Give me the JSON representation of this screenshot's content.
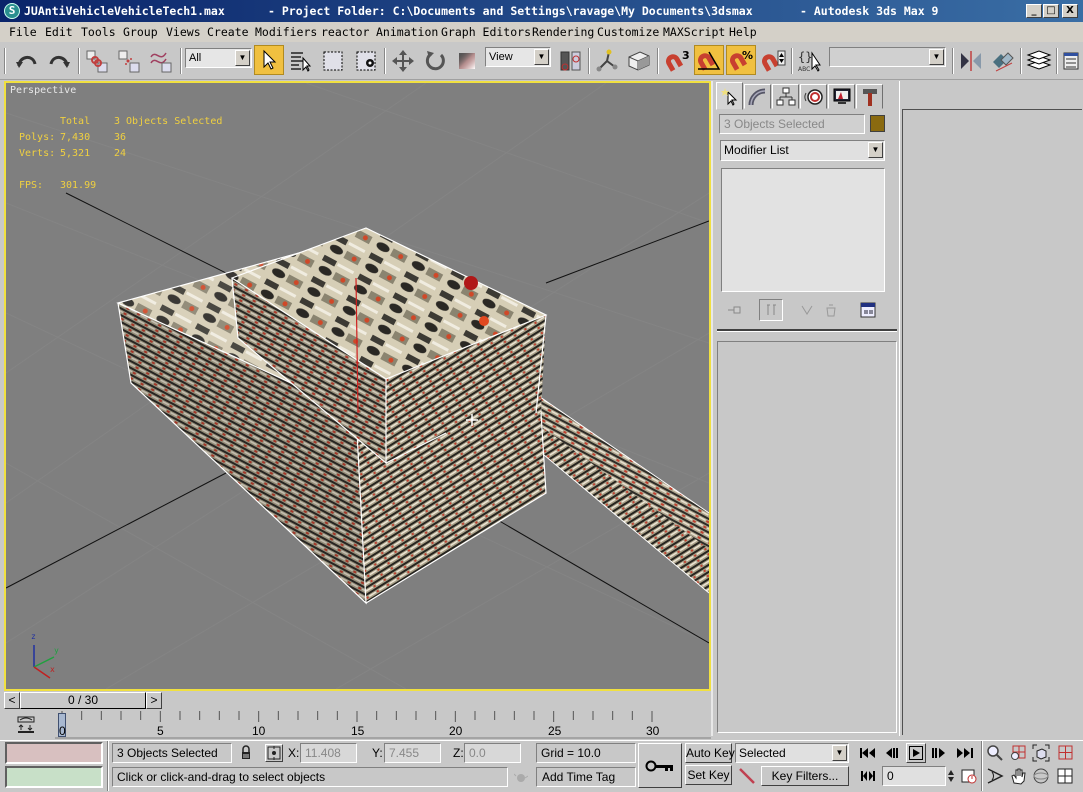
{
  "window": {
    "file_name": "JUAntiVehicleVehicleTech1.max",
    "project_folder": "- Project Folder: C:\\Documents and Settings\\ravage\\My Documents\\3dsmax",
    "app_name": "- Autodesk 3ds Max 9",
    "minimize": "_",
    "maximize": "□",
    "close": "X"
  },
  "menu": [
    "File",
    "Edit",
    "Tools",
    "Group",
    "Views",
    "Create",
    "Modifiers",
    "reactor",
    "Animation",
    "Graph Editors",
    "Rendering",
    "Customize",
    "MAXScript",
    "Help"
  ],
  "toolbar": {
    "selection_filter": "All",
    "reference_coord": "View",
    "named_selection": "",
    "icons": [
      "undo-icon",
      "redo-icon",
      "select-and-link-icon",
      "unlink-selection-icon",
      "bind-to-space-warp-icon",
      "select-object-icon",
      "select-by-name-icon",
      "rectangular-selection-icon",
      "window-crossing-icon",
      "select-and-move-icon",
      "select-and-rotate-icon",
      "select-and-scale-icon",
      "use-pivot-center-icon",
      "select-and-manipulate-icon",
      "keyboard-shortcut-override-icon",
      "snap-3d-icon",
      "angle-snap-icon",
      "percent-snap-icon",
      "spinner-snap-icon",
      "edit-named-selection-icon",
      "mirror-icon",
      "align-icon",
      "layer-manager-icon",
      "curve-editor-icon"
    ]
  },
  "viewport": {
    "label": "Perspective",
    "stats": {
      "header_total": "Total",
      "header_selected": "3 Objects Selected",
      "polys_label": "Polys:",
      "polys_total": "7,430",
      "polys_selected": "36",
      "verts_label": "Verts:",
      "verts_total": "5,321",
      "verts_selected": "24",
      "fps_label": "FPS:",
      "fps_value": "301.99"
    },
    "axis": {
      "x": "x",
      "y": "y",
      "z": "z"
    }
  },
  "command_panel": {
    "tabs": [
      "create-tab",
      "modify-tab",
      "hierarchy-tab",
      "motion-tab",
      "display-tab",
      "utilities-tab"
    ],
    "object_name": "3 Objects Selected",
    "object_color": "#8a6a10",
    "modifier_list": "Modifier List"
  },
  "time_slider": {
    "current": "0 / 30",
    "prev": "<",
    "next": ">"
  },
  "trackbar": {
    "ticks": [
      "0",
      "5",
      "10",
      "15",
      "20",
      "25",
      "30"
    ]
  },
  "status": {
    "selection_info": "3 Objects Selected",
    "prompt": "Click or click-and-drag to select objects",
    "x_label": "X:",
    "x_value": "11.408",
    "y_label": "Y:",
    "y_value": "7.455",
    "z_label": "Z:",
    "z_value": "0.0",
    "grid": "Grid = 10.0",
    "add_time_tag": "Add Time Tag",
    "auto_key": "Auto Key",
    "set_key": "Set Key",
    "key_mode": "Selected",
    "key_filters": "Key Filters...",
    "current_frame": "0"
  },
  "colors": {
    "viewport_border": "#f0e040",
    "title_start": "#0a246a",
    "title_end": "#3a6ea5",
    "active_tool": "#f0c040",
    "stats_text": "#f0d040"
  }
}
